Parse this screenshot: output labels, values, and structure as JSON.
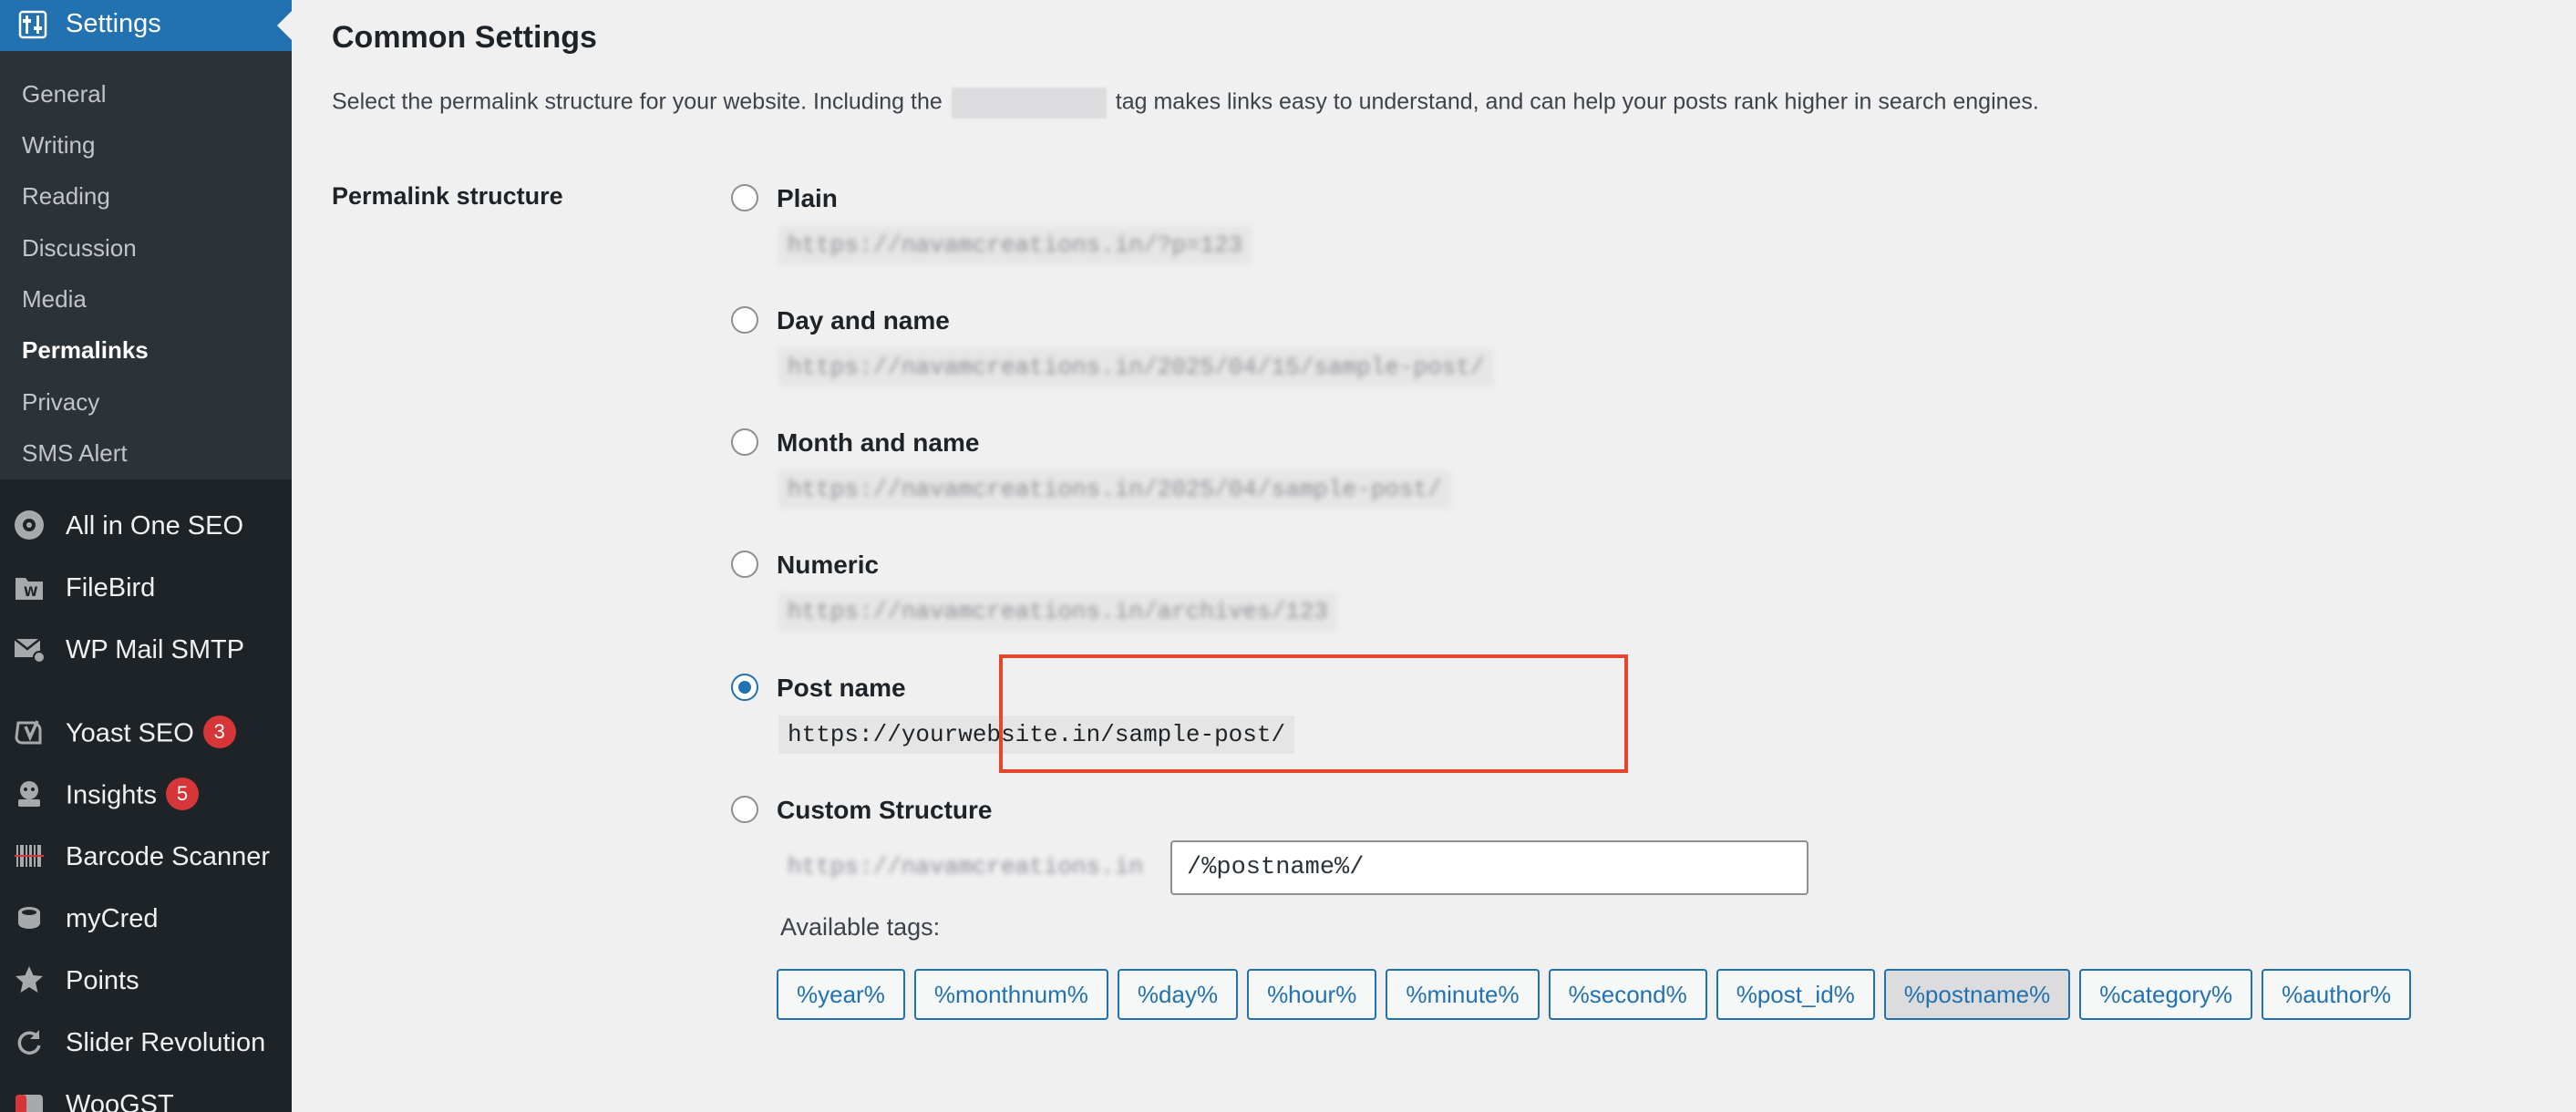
{
  "sidebar": {
    "active_menu": "Settings",
    "submenu": [
      "General",
      "Writing",
      "Reading",
      "Discussion",
      "Media",
      "Permalinks",
      "Privacy",
      "SMS Alert"
    ],
    "current_submenu": "Permalinks",
    "items": [
      {
        "label": "All in One SEO",
        "icon": "aioseo-icon"
      },
      {
        "label": "FileBird",
        "icon": "filebird-icon"
      },
      {
        "label": "WP Mail SMTP",
        "icon": "mail-icon"
      },
      {
        "label": "Yoast SEO",
        "icon": "yoast-icon",
        "badge": "3"
      },
      {
        "label": "Insights",
        "icon": "insights-icon",
        "badge": "5"
      },
      {
        "label": "Barcode Scanner",
        "icon": "barcode-icon"
      },
      {
        "label": "myCred",
        "icon": "mycred-icon"
      },
      {
        "label": "Points",
        "icon": "star-icon"
      },
      {
        "label": "Slider Revolution",
        "icon": "refresh-icon"
      },
      {
        "label": "WooGST",
        "icon": "woogst-icon"
      }
    ]
  },
  "main": {
    "title": "Common Settings",
    "intro_before": "Select the permalink structure for your website. Including the",
    "intro_after": "tag makes links easy to understand, and can help your posts rank higher in search engines.",
    "field_label": "Permalink structure",
    "options": [
      {
        "label": "Plain",
        "example": "https://navamcreations.in/?p=123",
        "checked": false,
        "blurred": true
      },
      {
        "label": "Day and name",
        "example": "https://navamcreations.in/2025/04/15/sample-post/",
        "checked": false,
        "blurred": true
      },
      {
        "label": "Month and name",
        "example": "https://navamcreations.in/2025/04/sample-post/",
        "checked": false,
        "blurred": true
      },
      {
        "label": "Numeric",
        "example": "https://navamcreations.in/archives/123",
        "checked": false,
        "blurred": true
      },
      {
        "label": "Post name",
        "example": "https://yourwebsite.in/sample-post/",
        "checked": true,
        "blurred": false
      },
      {
        "label": "Custom Structure",
        "checked": false
      }
    ],
    "custom": {
      "prefix": "https://navamcreations.in",
      "value": "/%postname%/"
    },
    "available_tags_label": "Available tags:",
    "tags": [
      "%year%",
      "%monthnum%",
      "%day%",
      "%hour%",
      "%minute%",
      "%second%",
      "%post_id%",
      "%postname%",
      "%category%",
      "%author%"
    ],
    "active_tag": "%postname%"
  },
  "colors": {
    "accent": "#2271b1",
    "sidebar_bg": "#1d2327",
    "highlight": "#e5472c",
    "badge": "#d63638"
  }
}
